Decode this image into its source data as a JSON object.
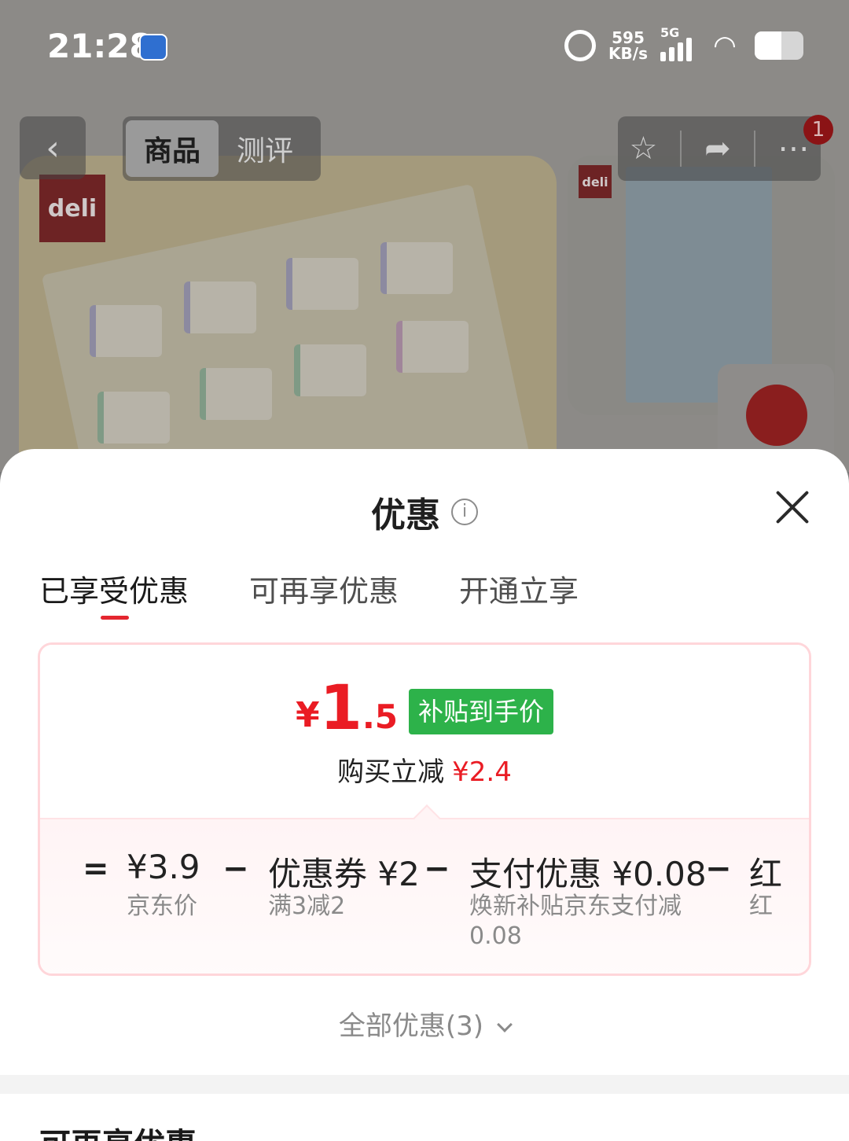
{
  "status_bar": {
    "time": "21:28",
    "netspeed_value": "595",
    "netspeed_unit": "KB/s",
    "network": "5G",
    "battery_level": 0.55
  },
  "nav": {
    "tabs": [
      "商品",
      "测评"
    ],
    "active_tab": 0,
    "badge_count": "1"
  },
  "background": {
    "brand_logo": "deli"
  },
  "sheet": {
    "title": "优惠",
    "tabs": [
      "已享受优惠",
      "可再享优惠",
      "开通立享"
    ],
    "active_tab": 0,
    "price": {
      "symbol": "¥",
      "integer": "1",
      "decimal": ".5",
      "badge": "补贴到手价",
      "saving_label": "购买立减",
      "saving_amount": "¥2.4"
    },
    "breakdown": {
      "equals": "=",
      "minus": "−",
      "items": [
        {
          "main": "¥3.9",
          "sub": "京东价"
        },
        {
          "main": "优惠券 ¥2",
          "sub": "满3减2"
        },
        {
          "main": "支付优惠 ¥0.08",
          "sub": "焕新补贴京东支付减0.08"
        },
        {
          "main": "红",
          "sub": "红"
        }
      ]
    },
    "all_deals": "全部优惠(3)",
    "next_section_title": "可再享优惠"
  },
  "colors": {
    "accent_red": "#ea1c24",
    "badge_green": "#2db24a",
    "card_border": "#ffd6da"
  }
}
